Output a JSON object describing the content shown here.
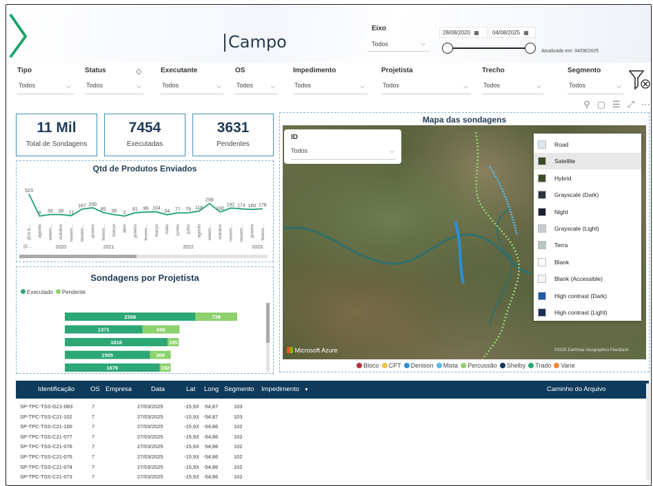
{
  "header": {
    "title": "Campo",
    "eixo_label": "Eixo",
    "eixo_value": "Todos",
    "date_start": "28/08/2020",
    "date_end": "04/08/2025",
    "updated": "Atualizado em: 04/08/2025"
  },
  "filters": [
    {
      "label": "Tipo",
      "value": "Todos"
    },
    {
      "label": "Status",
      "value": "Todos"
    },
    {
      "label": "Executante",
      "value": "Todos"
    },
    {
      "label": "OS",
      "value": "Todos"
    },
    {
      "label": "Impedimento",
      "value": "Todos"
    },
    {
      "label": "Projetista",
      "value": "Todos"
    },
    {
      "label": "Trecho",
      "value": "Todos"
    },
    {
      "label": "Segmento",
      "value": "Todos"
    }
  ],
  "kpis": [
    {
      "value": "11 Mil",
      "label": "Total de Sondagens"
    },
    {
      "value": "7454",
      "label": "Executadas"
    },
    {
      "value": "3631",
      "label": "Pendentes"
    }
  ],
  "line_chart": {
    "title": "Qtd de Produtos Enviados"
  },
  "bar_chart": {
    "title": "Sondagens por Projetista"
  },
  "map": {
    "title": "Mapa das sondagens",
    "id_label": "ID",
    "id_value": "Todos",
    "styles": [
      "Road",
      "Satellite",
      "Hybrid",
      "Grayscale (Dark)",
      "Night",
      "Grayscale (Light)",
      "Terra",
      "Blank",
      "Blank (Accessible)",
      "High contrast (Dark)",
      "High contrast (Light)"
    ],
    "active_style": "Satellite",
    "brand": "Microsoft Azure",
    "credit": "©2025 Earthstar Geographics  Feedback",
    "legend": [
      {
        "name": "Bloco",
        "color": "#b5323c"
      },
      {
        "name": "CPT",
        "color": "#f0c24a"
      },
      {
        "name": "Denison",
        "color": "#2a8fd8"
      },
      {
        "name": "Mista",
        "color": "#56b9e8"
      },
      {
        "name": "Percussão",
        "color": "#8ed16f"
      },
      {
        "name": "Shelby",
        "color": "#0e3a5c"
      },
      {
        "name": "Trado",
        "color": "#2ca776"
      },
      {
        "name": "Vane",
        "color": "#e8893a"
      }
    ]
  },
  "table": {
    "headers": [
      "Identificação",
      "OS",
      "Empresa",
      "Data",
      "Lat",
      "Long",
      "Segmento",
      "Impedimento",
      "Caminho do Arquivo"
    ],
    "rows": [
      [
        "SP-TPC-TSS-G21-083",
        "7",
        "",
        "27/03/2025",
        "-15,93",
        "-54,87",
        "103"
      ],
      [
        "SP-TPC-TSS-C21-102",
        "7",
        "",
        "27/03/2025",
        "-15,93",
        "-54,87",
        "103"
      ],
      [
        "SP-TPC-TSS-C21-100",
        "7",
        "",
        "27/03/2025",
        "-15,93",
        "-54,86",
        "102"
      ],
      [
        "SP-TPC-TSS-C21-077",
        "7",
        "",
        "27/03/2025",
        "-15,93",
        "-54,86",
        "102"
      ],
      [
        "SP-TPC-TSS-C21-076",
        "7",
        "",
        "27/03/2025",
        "-15,93",
        "-54,86",
        "102"
      ],
      [
        "SP-TPC-TSS-C21-075",
        "7",
        "",
        "27/03/2025",
        "-15,93",
        "-54,86",
        "102"
      ],
      [
        "SP-TPC-TSS-C21-074",
        "7",
        "",
        "27/03/2025",
        "-15,93",
        "-54,86",
        "102"
      ],
      [
        "SP-TPC-TSS-C21-073",
        "7",
        "",
        "27/03/2025",
        "-15,93",
        "-54,86",
        "102"
      ]
    ]
  },
  "chart_data": [
    {
      "type": "line",
      "title": "Qtd de Produtos Enviados",
      "categories": [
        "(Em b...",
        "agosto",
        "setem...",
        "outubro",
        "novem...",
        "dezem...",
        "janeiro",
        "fevere...",
        "março",
        "abril",
        "janeiro",
        "fevere...",
        "março",
        "maio",
        "junho",
        "julho",
        "agosto",
        "setem...",
        "outubro",
        "novem...",
        "dezem...",
        "janeiro",
        "fevere..."
      ],
      "category_prefix": [
        "(E...",
        "",
        "",
        "",
        "",
        "",
        "",
        "",
        "",
        "",
        "",
        "",
        "",
        "",
        "",
        "",
        "",
        "",
        "",
        "",
        "",
        "",
        ""
      ],
      "years": [
        {
          "label": "2020",
          "start": 1,
          "end": 5
        },
        {
          "label": "2021",
          "start": 6,
          "end": 9
        },
        {
          "label": "2022",
          "start": 10,
          "end": 20
        },
        {
          "label": "2023",
          "start": 21,
          "end": 22
        }
      ],
      "values": [
        523,
        4,
        39,
        38,
        11,
        167,
        200,
        85,
        38,
        2,
        81,
        99,
        104,
        34,
        77,
        79,
        118,
        299,
        100,
        192,
        174,
        160,
        176
      ],
      "color": "#2ca776"
    },
    {
      "type": "bar",
      "title": "Sondagens por Projetista",
      "orientation": "horizontal",
      "stacked": true,
      "categories": [
        "",
        "",
        "",
        "",
        ""
      ],
      "series": [
        {
          "name": "Executado",
          "color": "#2ca776",
          "values": [
            2308,
            1371,
            1818,
            1505,
            1679
          ]
        },
        {
          "name": "Pendente",
          "color": "#8ed16f",
          "values": [
            738,
            656,
            195,
            368,
            192
          ]
        }
      ]
    }
  ]
}
